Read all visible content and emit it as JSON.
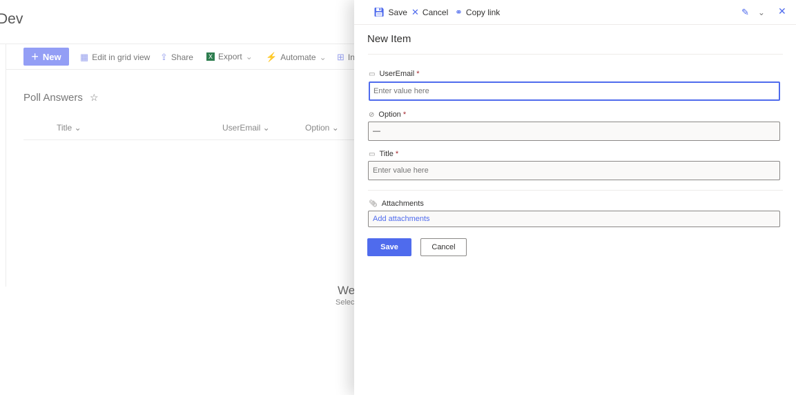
{
  "background": {
    "site_title": "Dev",
    "commands": {
      "new": "New",
      "edit_grid": "Edit in grid view",
      "share": "Share",
      "export": "Export",
      "automate": "Automate",
      "integrate": "In"
    },
    "list_title": "Poll Answers",
    "columns": [
      "Title",
      "UserEmail",
      "Option"
    ],
    "empty_title": "We",
    "empty_sub": "Selec"
  },
  "panel": {
    "toolbar": {
      "save": "Save",
      "cancel": "Cancel",
      "copy_link": "Copy link"
    },
    "title": "New Item",
    "fields": [
      {
        "label": "UserEmail",
        "required": "*",
        "icon": "text-field-icon",
        "placeholder": "Enter value here"
      },
      {
        "label": "Option",
        "required": "*",
        "icon": "choice-icon",
        "value": "—"
      },
      {
        "label": "Title",
        "required": "*",
        "icon": "text-field-icon",
        "placeholder": "Enter value here"
      }
    ],
    "attachments": {
      "label": "Attachments",
      "link": "Add attachments"
    },
    "save_button": "Save",
    "cancel_button": "Cancel"
  },
  "colors": {
    "accent": "#4f6bed",
    "required": "#a4262c"
  }
}
